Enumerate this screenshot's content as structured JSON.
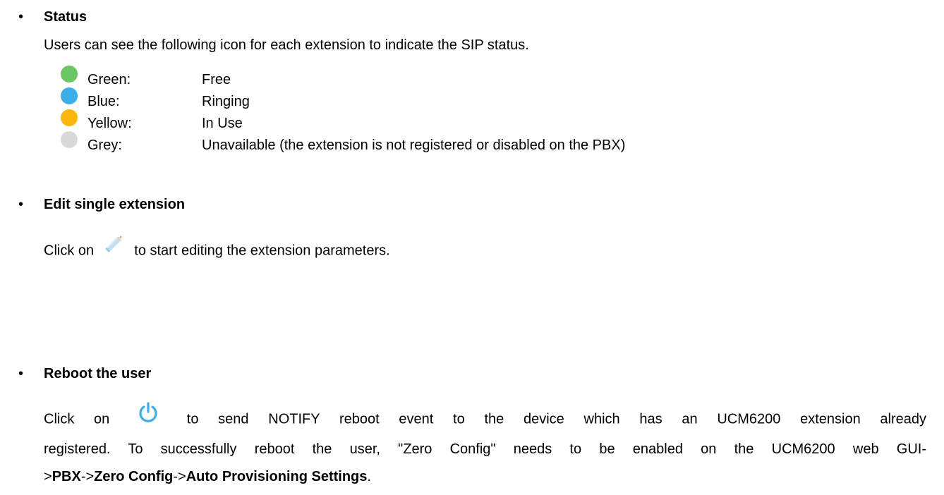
{
  "status_section": {
    "bullet": "•",
    "heading": "Status",
    "intro": "Users can see the following icon for each extension to indicate the SIP status.",
    "items": [
      {
        "color_name": "Green:",
        "meaning": "Free",
        "dot_color": "#6cc563"
      },
      {
        "color_name": "Blue:",
        "meaning": "Ringing",
        "dot_color": "#3aaee8"
      },
      {
        "color_name": "Yellow:",
        "meaning": "In Use",
        "dot_color": "#fbb80a"
      },
      {
        "color_name": "Grey:",
        "meaning": "Unavailable (the extension is not registered or disabled on the PBX)",
        "dot_color": "#d9d9d9"
      }
    ]
  },
  "edit_section": {
    "bullet": "•",
    "heading": "Edit single extension",
    "text_before": "Click on",
    "icon": "pencil-icon",
    "text_after": "to start editing the extension parameters."
  },
  "reboot_section": {
    "bullet": "•",
    "heading": "Reboot the user",
    "line1_before": "Click on",
    "icon": "power-icon",
    "icon_color": "#3aaee8",
    "line1_after": "to send NOTIFY reboot event to the device which has an UCM6200 extension already",
    "line2": "registered. To successfully reboot the user, \"Zero Config\" needs to be enabled on the UCM6200 web GUI-",
    "line3_prefix": ">",
    "line3_bold1": "PBX",
    "line3_sep1": "->",
    "line3_bold2": "Zero Config",
    "line3_sep2": "->",
    "line3_bold3": "Auto Provisioning Settings",
    "line3_end": "."
  }
}
